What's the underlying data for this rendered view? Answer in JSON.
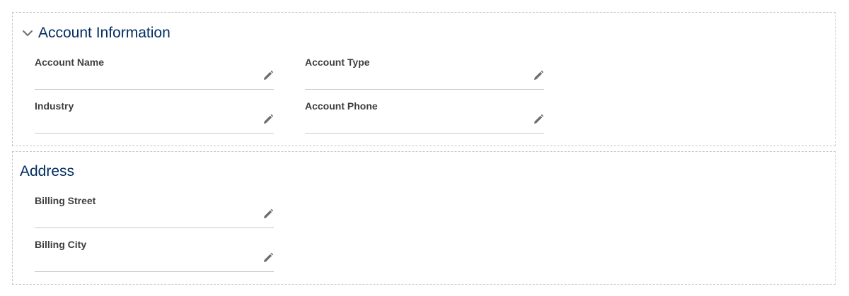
{
  "sections": {
    "account": {
      "title": "Account Information",
      "fields": {
        "account_name": {
          "label": "Account Name",
          "value": ""
        },
        "account_type": {
          "label": "Account Type",
          "value": ""
        },
        "industry": {
          "label": "Industry",
          "value": ""
        },
        "account_phone": {
          "label": "Account Phone",
          "value": ""
        }
      }
    },
    "address": {
      "title": "Address",
      "fields": {
        "billing_street": {
          "label": "Billing Street",
          "value": ""
        },
        "billing_city": {
          "label": "Billing City",
          "value": ""
        }
      }
    }
  },
  "icons": {
    "chevron": "chevron-down-icon",
    "edit": "pencil-icon"
  },
  "colors": {
    "title": "#032d60",
    "label": "#3e3e3c",
    "icon": "#706e6b",
    "divider": "#c9c9c9",
    "section_border": "#c9c7c5"
  }
}
